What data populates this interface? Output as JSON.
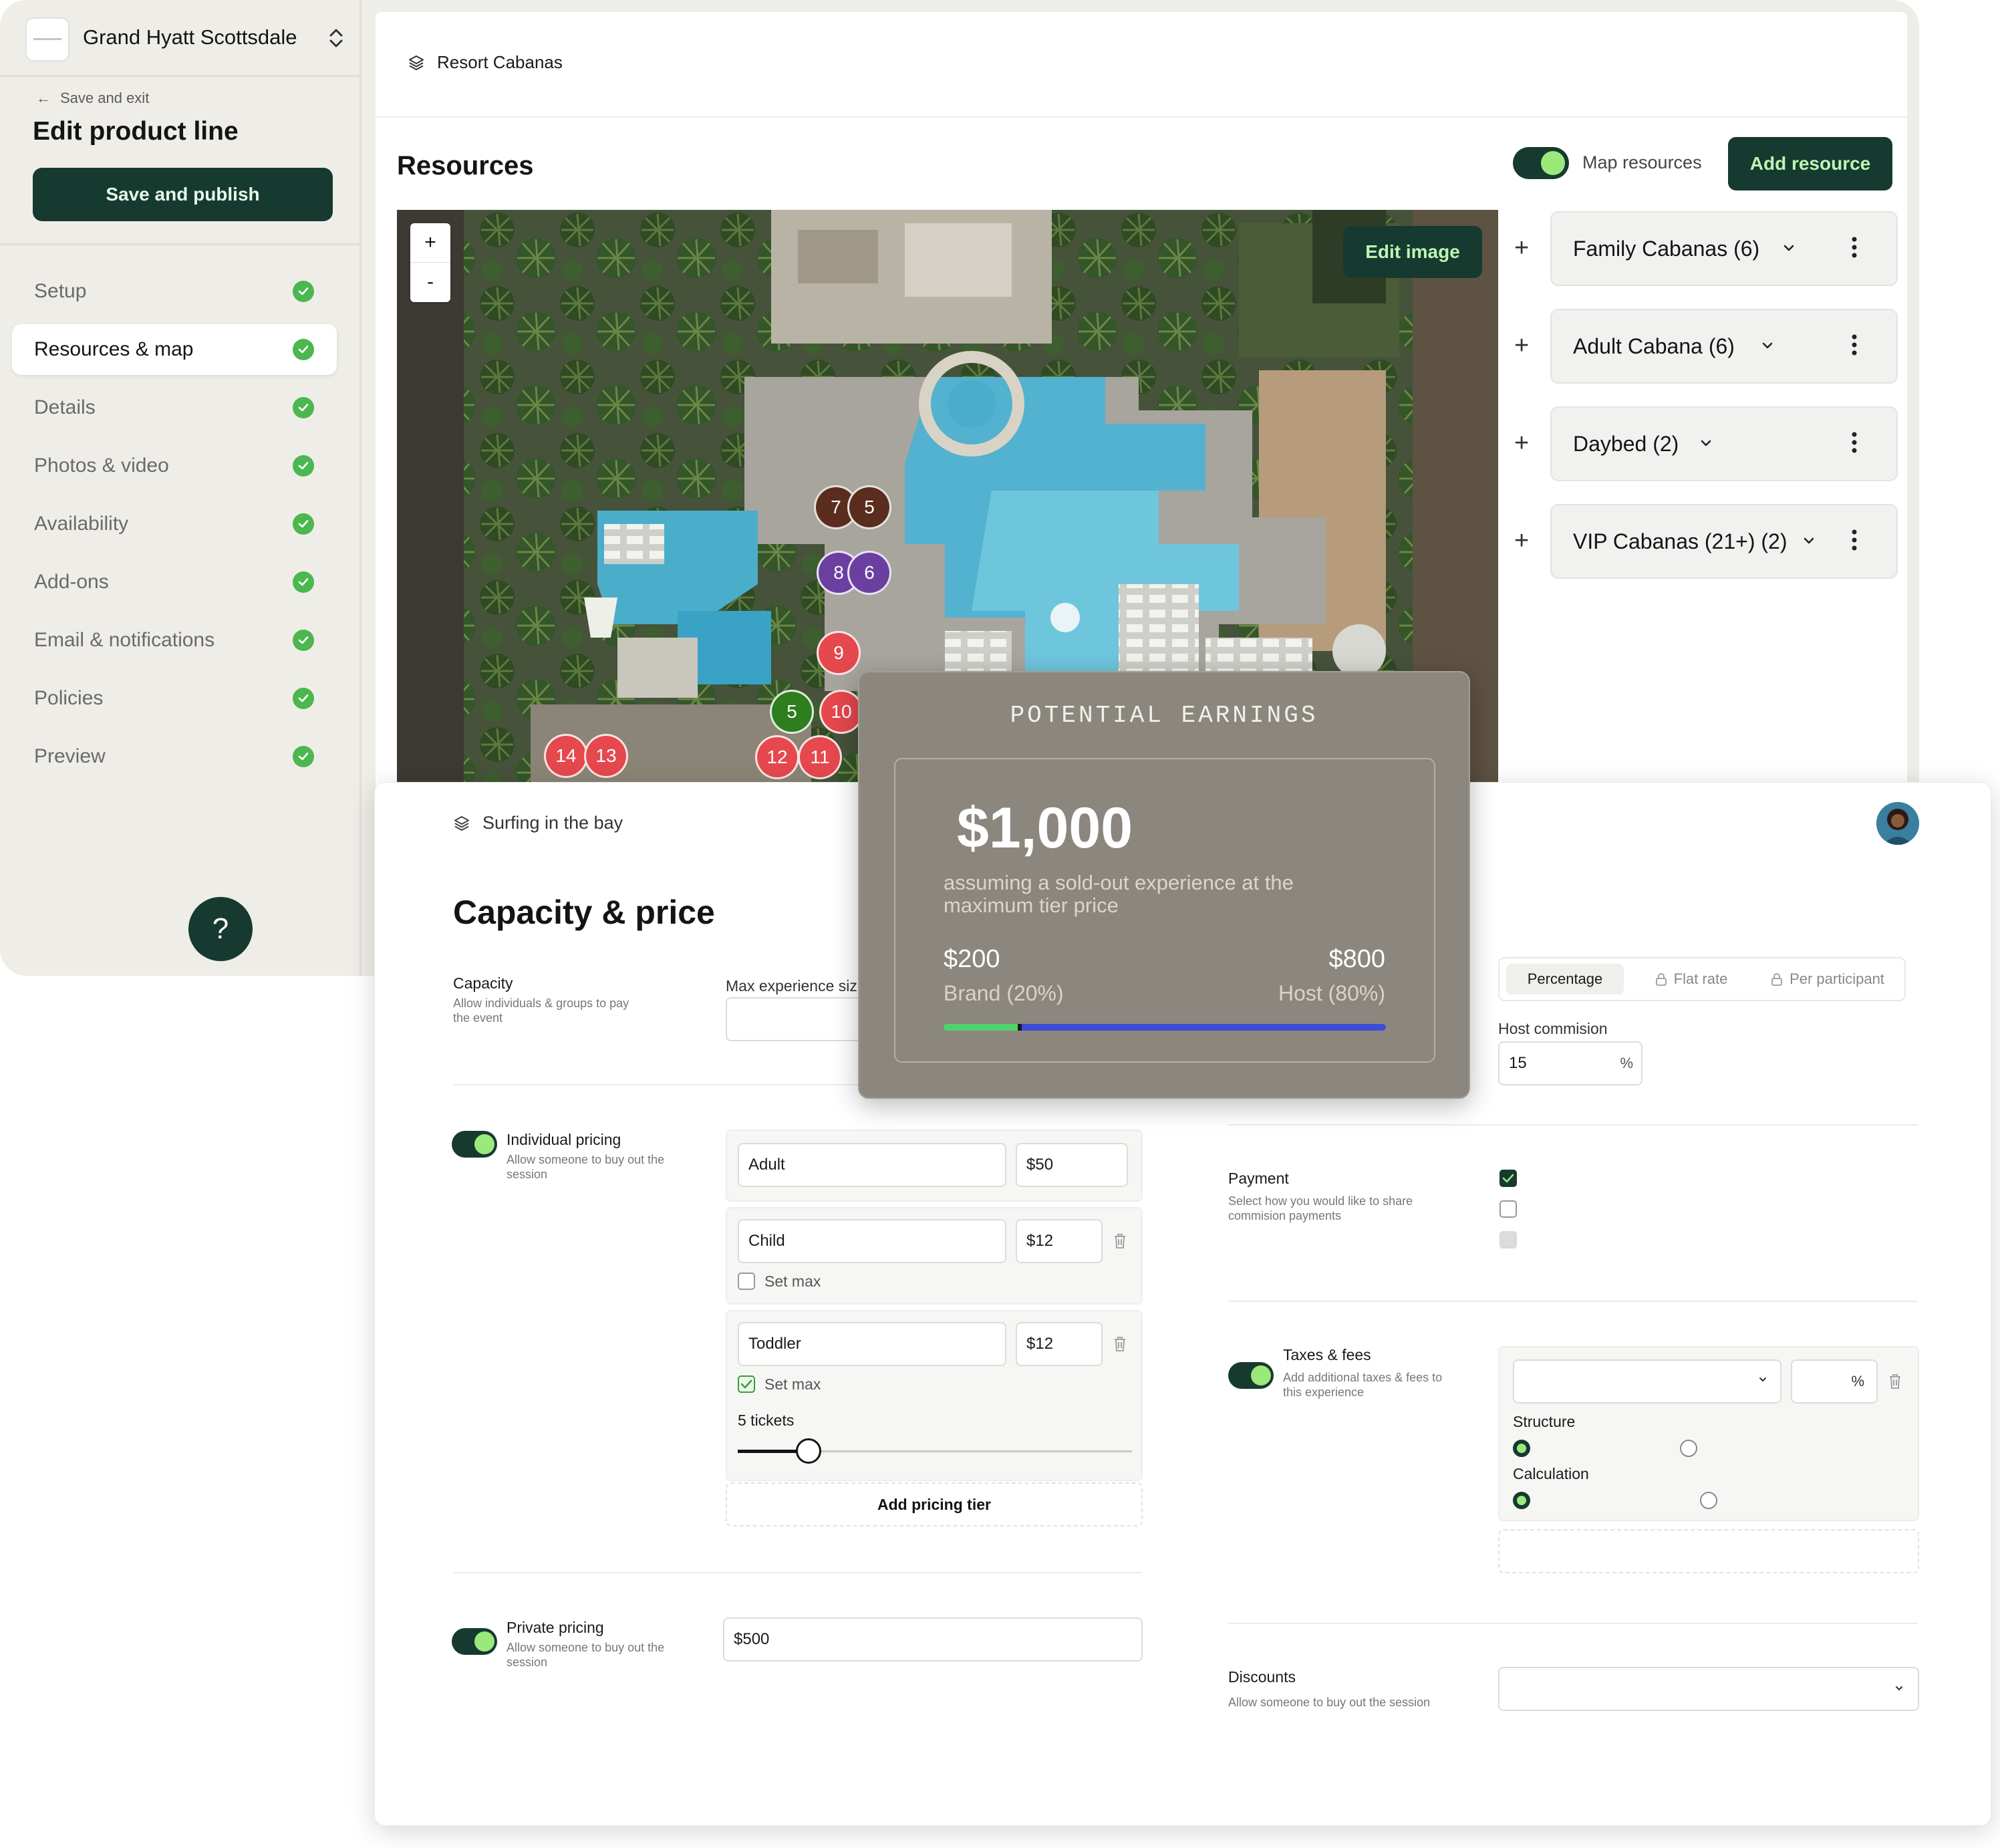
{
  "colors": {
    "accent": "#163a30",
    "accent_light": "#9be97a",
    "success": "#4bb74e",
    "pin_red": "#e5484d",
    "pin_brown": "#5a2d1e",
    "pin_purple": "#6b3fa0",
    "pin_green": "#2e7d1f",
    "brand_bar": "#4fd36a",
    "host_bar": "#3e4bd6"
  },
  "sidebar": {
    "venue": "Grand Hyatt Scottsdale",
    "save_exit": "Save and exit",
    "title": "Edit product line",
    "publish": "Save and publish",
    "nav": [
      {
        "label": "Setup",
        "done": true
      },
      {
        "label": "Resources & map",
        "done": true,
        "active": true
      },
      {
        "label": "Details",
        "done": true
      },
      {
        "label": "Photos & video",
        "done": true
      },
      {
        "label": "Availability",
        "done": true
      },
      {
        "label": "Add-ons",
        "done": true
      },
      {
        "label": "Email & notifications",
        "done": true
      },
      {
        "label": "Policies",
        "done": true
      },
      {
        "label": "Preview",
        "done": true
      }
    ],
    "help": "?"
  },
  "resources": {
    "breadcrumb": "Resort Cabanas",
    "title": "Resources",
    "map_toggle_label": "Map resources",
    "map_toggle_on": true,
    "add_button": "Add resource",
    "edit_image": "Edit image",
    "zoom_in": "+",
    "zoom_out": "-",
    "list": [
      {
        "name": "Family Cabanas (6)"
      },
      {
        "name": "Adult Cabana (6)"
      },
      {
        "name": "Daybed (2)"
      },
      {
        "name": "VIP Cabanas (21+) (2)"
      }
    ],
    "pins": [
      "7",
      "5",
      "8",
      "6",
      "9",
      "5",
      "10",
      "12",
      "11",
      "14",
      "13"
    ]
  },
  "capacity": {
    "breadcrumb": "Surfing in the bay",
    "title": "Capacity & price",
    "capacity_label": "Capacity",
    "capacity_desc": "Allow individuals & groups to pay the event",
    "max_size_label": "Max experience siz",
    "individual_label": "Individual pricing",
    "individual_desc": "Allow someone to buy out the session",
    "tiers": [
      {
        "name": "Adult",
        "price": "$50"
      },
      {
        "name": "Child",
        "price": "$12",
        "set_max": "Set max",
        "max_checked": false
      },
      {
        "name": "Toddler",
        "price": "$12",
        "set_max": "Set max",
        "max_checked": true,
        "tickets_label": "5 tickets",
        "slider_fraction": 0.18
      }
    ],
    "add_tier": "Add pricing tier",
    "private_label": "Private pricing",
    "private_desc": "Allow someone to buy out the session",
    "private_price": "$500"
  },
  "commission": {
    "tabs": [
      "Percentage",
      "Flat rate",
      "Per participant"
    ],
    "host_label": "Host commision",
    "host_value": "15",
    "host_unit": "%",
    "payment_label": "Payment",
    "payment_desc": "Select how you would like to share commision payments",
    "taxes_label": "Taxes & fees",
    "taxes_desc": "Add additional taxes & fees to this experience",
    "taxes_unit": "%",
    "structure_label": "Structure",
    "calculation_label": "Calculation",
    "discounts_label": "Discounts",
    "discounts_desc": "Allow someone to buy out the session"
  },
  "earnings": {
    "title": "POTENTIAL EARNINGS",
    "total": "$1,000",
    "subtitle": "assuming a sold-out experience at the maximum tier price",
    "brand_amount": "$200",
    "brand_label": "Brand (20%)",
    "host_amount": "$800",
    "host_label": "Host (80%)",
    "brand_share": 0.2
  }
}
